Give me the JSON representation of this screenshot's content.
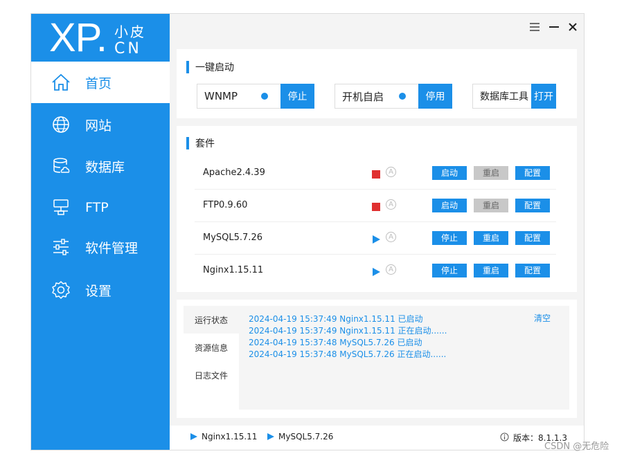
{
  "logo": {
    "main": "XP.",
    "top": "小皮",
    "bottom": "CN"
  },
  "nav": [
    {
      "label": "首页",
      "icon": "home-icon"
    },
    {
      "label": "网站",
      "icon": "globe-icon"
    },
    {
      "label": "数据库",
      "icon": "database-icon"
    },
    {
      "label": "FTP",
      "icon": "server-icon"
    },
    {
      "label": "软件管理",
      "icon": "sliders-icon"
    },
    {
      "label": "设置",
      "icon": "gear-icon"
    }
  ],
  "quickstart": {
    "title": "一键启动",
    "items": [
      {
        "label": "WNMP",
        "button": "停止"
      },
      {
        "label": "开机自启",
        "button": "停用"
      },
      {
        "label": "数据库工具",
        "button": "打开"
      }
    ]
  },
  "suite": {
    "title": "套件",
    "rows": [
      {
        "name": "Apache2.4.39",
        "status": "stopped",
        "start_label": "启动",
        "restart_label": "重启",
        "config_label": "配置"
      },
      {
        "name": "FTP0.9.60",
        "status": "stopped",
        "start_label": "启动",
        "restart_label": "重启",
        "config_label": "配置"
      },
      {
        "name": "MySQL5.7.26",
        "status": "running",
        "start_label": "停止",
        "restart_label": "重启",
        "config_label": "配置"
      },
      {
        "name": "Nginx1.15.11",
        "status": "running",
        "start_label": "停止",
        "restart_label": "重启",
        "config_label": "配置"
      }
    ],
    "auto_glyph": "A"
  },
  "log": {
    "tabs": [
      "运行状态",
      "资源信息",
      "日志文件"
    ],
    "clear_label": "清空",
    "lines": [
      "2024-04-19 15:37:49 Nginx1.15.11 已启动",
      "2024-04-19 15:37:49 Nginx1.15.11 正在启动......",
      "2024-04-19 15:37:48 MySQL5.7.26 已启动",
      "2024-04-19 15:37:48 MySQL5.7.26 正在启动......"
    ]
  },
  "statusbar": {
    "running": [
      "Nginx1.15.11",
      "MySQL5.7.26"
    ],
    "version_label": "版本：",
    "version": "8.1.1.3"
  },
  "watermark": "CSDN @无危险",
  "colors": {
    "accent": "#1b8fe8",
    "stopped": "#e03030",
    "disabled": "#c8c8c8"
  }
}
